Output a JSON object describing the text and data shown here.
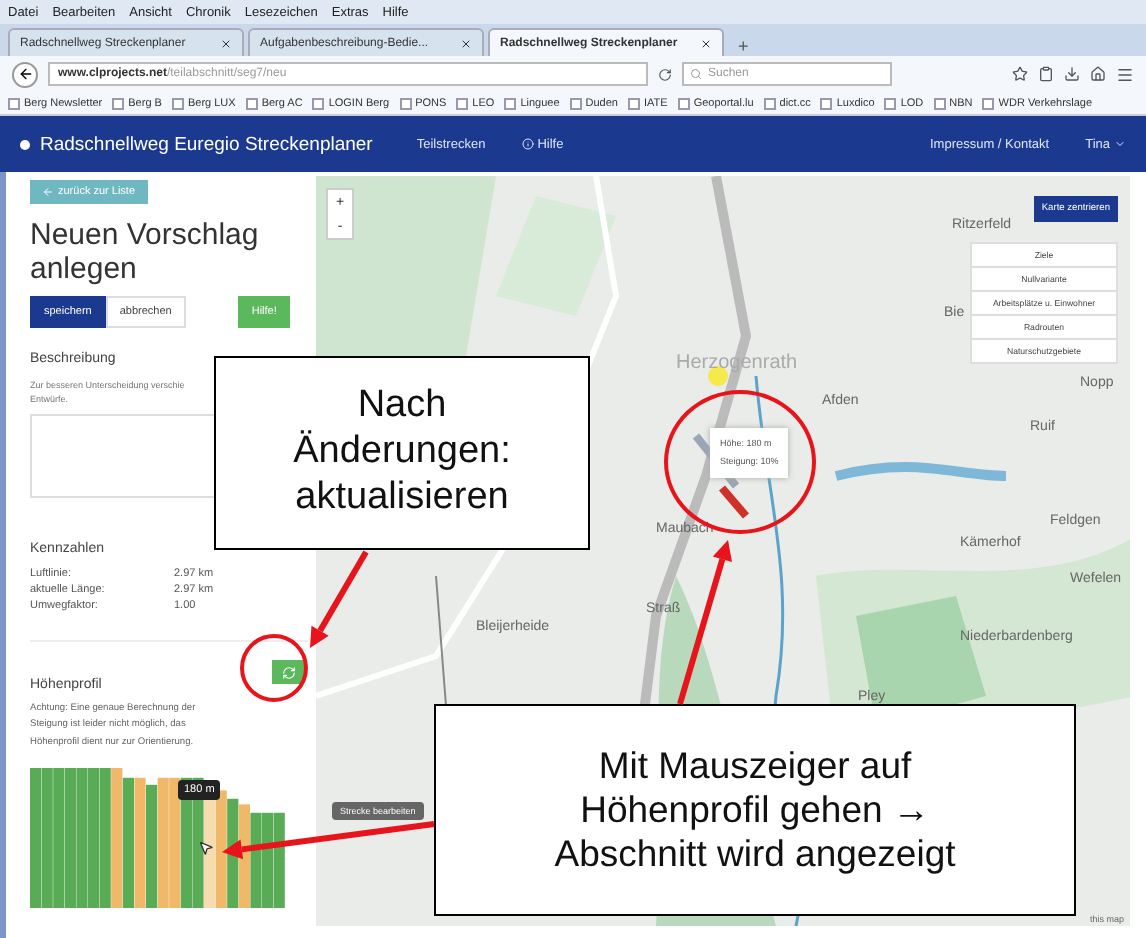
{
  "browser": {
    "menu": [
      "Datei",
      "Bearbeiten",
      "Ansicht",
      "Chronik",
      "Lesezeichen",
      "Extras",
      "Hilfe"
    ],
    "tabs": [
      {
        "label": "Radschnellweg Streckenplaner",
        "selected": false
      },
      {
        "label": "Aufgabenbeschreibung-Bedie...",
        "selected": false
      },
      {
        "label": "Radschnellweg Streckenplaner",
        "selected": true
      }
    ],
    "new_tab": "+",
    "address_host": "www.clprojects.net",
    "address_path": "/teilabschnitt/seg7/neu",
    "search_placeholder": "Suchen",
    "bookmarks": [
      "Berg Newsletter",
      "Berg B",
      "Berg LUX",
      "Berg AC",
      "LOGIN Berg",
      "PONS",
      "LEO",
      "Linguee",
      "Duden",
      "IATE",
      "Geoportal.lu",
      "dict.cc",
      "Luxdico",
      "LOD",
      "NBN",
      "WDR Verkehrslage"
    ]
  },
  "navbar": {
    "brand": "Radschnellweg Euregio Streckenplaner",
    "links": [
      "Teilstrecken",
      "Hilfe"
    ],
    "contact": "Impressum / Kontakt",
    "user": "Tina"
  },
  "sidebar": {
    "back_button": "zurück zur Liste",
    "heading": "Neuen Vorschlag anlegen",
    "buttons": [
      {
        "label": "speichern",
        "kind": "primary"
      },
      {
        "label": "abbrechen",
        "kind": "default"
      },
      {
        "label": "Hilfe!",
        "kind": "success"
      }
    ],
    "description": {
      "title": "Beschreibung",
      "hint_lines": [
        "Zur besseren Unterscheidung verschie",
        "Entwürfe."
      ]
    },
    "metrics": {
      "title": "Kennzahlen",
      "rows": [
        {
          "label": "Luftlinie:",
          "value": "2.97 km"
        },
        {
          "label": "aktuelle Länge:",
          "value": "2.97 km"
        },
        {
          "label": "Umwegfaktor:",
          "value": "1.00"
        }
      ]
    },
    "elevation": {
      "title": "Höhenprofil",
      "note": "Achtung: Eine genaue Berechnung der Steigung ist leider nicht möglich, das Höhenprofil dient nur zur Orientierung.",
      "tooltip": "180 m"
    }
  },
  "map": {
    "zoom_in": "+",
    "zoom_out": "-",
    "center_button": "Karte zentrieren",
    "layers": [
      "Ziele",
      "Nullvariante",
      "Arbeitsplätze u. Einwohner",
      "Radrouten",
      "Naturschutzgebiete"
    ],
    "places": [
      "Herzogenrath",
      "Afden",
      "Ritzerfeld",
      "Bie",
      "Nopp",
      "Ruif",
      "Feldgen",
      "Kämerhof",
      "Wefelen",
      "Niederbardenberg",
      "Bleijerheide",
      "Maubach",
      "Straß",
      "Pley"
    ],
    "popup": [
      "Höhe: 180 m",
      "Steigung: 10%"
    ],
    "edit_tooltip": "Strecke bearbeiten",
    "attribution": "this map"
  },
  "annotations": [
    {
      "lines": [
        "Nach",
        "Änderungen:",
        "aktualisieren"
      ]
    },
    {
      "lines": [
        "Mit Mauszeiger auf",
        "Höhenprofil gehen →",
        "Abschnitt wird angezeigt"
      ]
    }
  ]
}
